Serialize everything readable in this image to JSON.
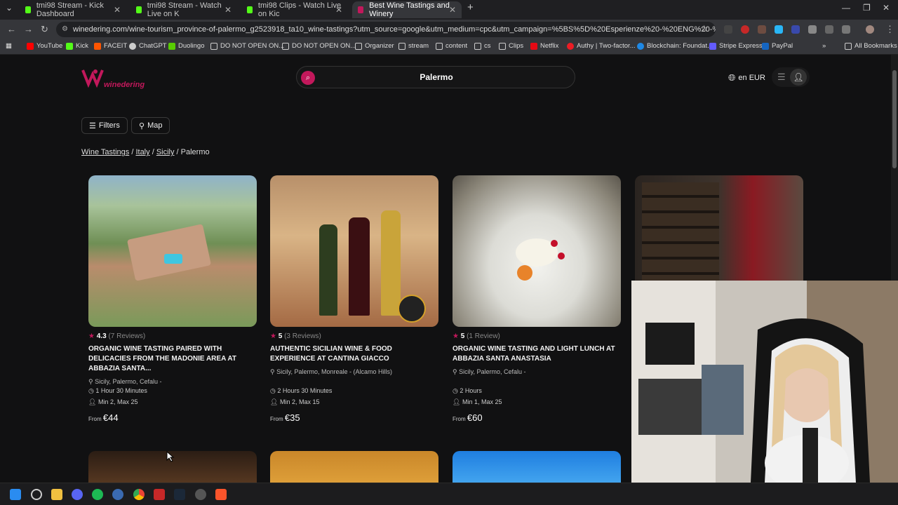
{
  "browser": {
    "tabs": [
      {
        "title": "tmi98 Stream - Kick Dashboard",
        "color": "#53fc18"
      },
      {
        "title": "tmi98 Stream - Watch Live on K",
        "color": "#53fc18"
      },
      {
        "title": "tmi98 Clips - Watch Live on Kic",
        "color": "#53fc18"
      },
      {
        "title": "Best Wine Tastings and Winery",
        "color": "#c2185b"
      }
    ],
    "url": "winedering.com/wine-tourism_province-of-palermo_g2523918_ta10_wine-tastings?utm_source=google&utm_medium=cpc&utm_campaign=%5BS%5D%20Esperienze%20-%20ENG%20-%20Italia%5Ben_IT%5D...",
    "bookmarks": [
      "YouTube",
      "Kick",
      "FACEIT",
      "ChatGPT",
      "Duolingo",
      "DO NOT OPEN ON...",
      "DO NOT OPEN ON...",
      "Organizer",
      "stream",
      "content",
      "cs",
      "Clips",
      "Netflix",
      "Authy | Two-factor...",
      "Blockchain: Foundat...",
      "Stripe Express",
      "PayPal"
    ],
    "all_bookmarks": "All Bookmarks"
  },
  "site": {
    "logo": "winedering",
    "search_value": "Palermo",
    "language": "en EUR",
    "filters_label": "Filters",
    "map_label": "Map",
    "breadcrumb": {
      "wine_tastings": "Wine Tastings",
      "italy": "Italy",
      "sicily": "Sicily",
      "current": "Palermo"
    }
  },
  "cards": [
    {
      "rating": "4.3",
      "reviews": "(7 Reviews)",
      "title": "ORGANIC WINE TASTING PAIRED WITH DELICACIES FROM THE MADONIE AREA AT ABBAZIA SANTA...",
      "location": "Sicily, Palermo, Cefalu -",
      "duration": "1 Hour 30 Minutes",
      "group": "Min 2, Max 25",
      "from": "From",
      "price": "€44"
    },
    {
      "rating": "5",
      "reviews": "(3 Reviews)",
      "title": "AUTHENTIC SICILIAN WINE & FOOD EXPERIENCE AT CANTINA GIACCO",
      "location": "Sicily, Palermo, Monreale - (Alcamo Hills)",
      "duration": "2 Hours 30 Minutes",
      "group": "Min 2, Max 15",
      "from": "From",
      "price": "€35"
    },
    {
      "rating": "5",
      "reviews": "(1 Review)",
      "title": "ORGANIC WINE TASTING AND LIGHT LUNCH AT ABBAZIA SANTA ANASTASIA",
      "location": "Sicily, Palermo, Cefalu -",
      "duration": "2 Hours",
      "group": "Min 1, Max 25",
      "from": "From",
      "price": "€60"
    }
  ],
  "colors": {
    "accent": "#c2185b",
    "background": "#111112"
  }
}
